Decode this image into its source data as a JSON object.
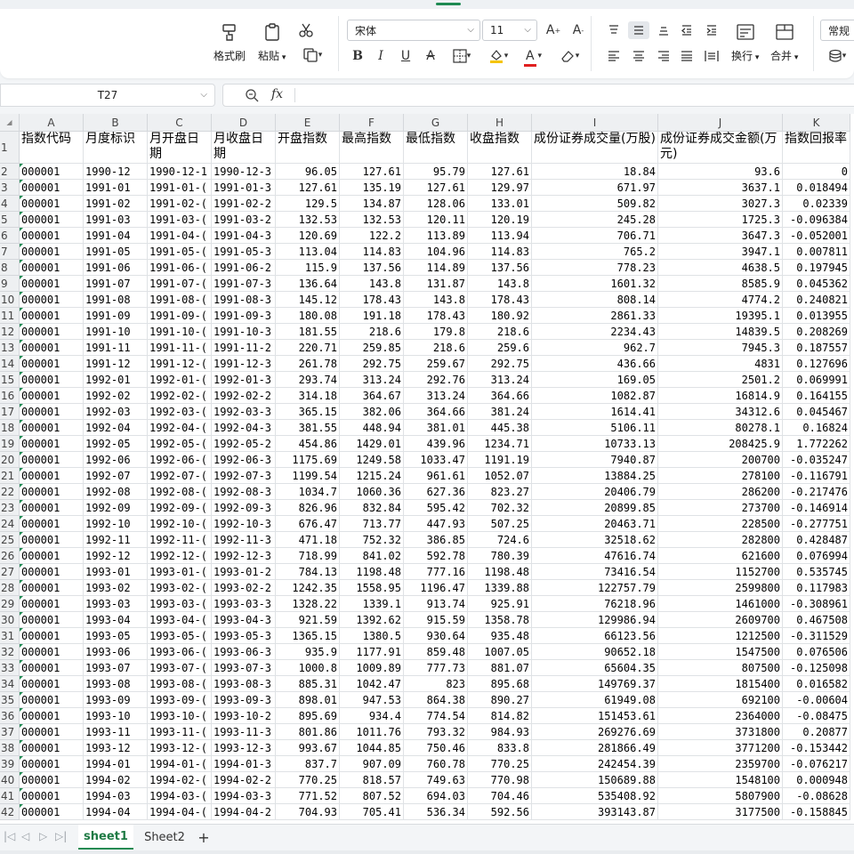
{
  "toolbar": {
    "format_painter": "格式刷",
    "paste": "粘贴",
    "font_name": "宋体",
    "font_size": "11",
    "wrap": "换行",
    "merge": "合并",
    "number_format": "常规",
    "bold": "B",
    "italic": "I",
    "underline": "U",
    "strike": "A",
    "font_color_letter": "A"
  },
  "formula_bar": {
    "name_box": "T27",
    "fx_label": "fx",
    "value": ""
  },
  "columns": [
    "A",
    "B",
    "C",
    "D",
    "E",
    "F",
    "G",
    "H",
    "I",
    "J",
    "K"
  ],
  "header_row": [
    "指数代码",
    "月度标识",
    "月开盘日期",
    "月收盘日期",
    "开盘指数",
    "最高指数",
    "最低指数",
    "收盘指数",
    "成份证券成交量(万股)",
    "成份证券成交金额(万元)",
    "指数回报率"
  ],
  "row_numbers": [
    "1",
    "2",
    "3",
    "4",
    "5",
    "6",
    "7",
    "8",
    "9",
    "10",
    "11",
    "12",
    "13",
    "14",
    "15",
    "16",
    "17",
    "18",
    "19",
    "20",
    "21",
    "22",
    "23",
    "24",
    "25",
    "26",
    "27",
    "28",
    "29",
    "30",
    "31",
    "32",
    "33",
    "34",
    "35",
    "36",
    "37",
    "38",
    "39",
    "40",
    "41",
    "42"
  ],
  "rows": [
    [
      "000001",
      "1990-12",
      "1990-12-1",
      "1990-12-3",
      "96.05",
      "127.61",
      "95.79",
      "127.61",
      "18.84",
      "93.6",
      "0"
    ],
    [
      "000001",
      "1991-01",
      "1991-01-(",
      "1991-01-3",
      "127.61",
      "135.19",
      "127.61",
      "129.97",
      "671.97",
      "3637.1",
      "0.018494"
    ],
    [
      "000001",
      "1991-02",
      "1991-02-(",
      "1991-02-2",
      "129.5",
      "134.87",
      "128.06",
      "133.01",
      "509.82",
      "3027.3",
      "0.02339"
    ],
    [
      "000001",
      "1991-03",
      "1991-03-(",
      "1991-03-2",
      "132.53",
      "132.53",
      "120.11",
      "120.19",
      "245.28",
      "1725.3",
      "-0.096384"
    ],
    [
      "000001",
      "1991-04",
      "1991-04-(",
      "1991-04-3",
      "120.69",
      "122.2",
      "113.89",
      "113.94",
      "706.71",
      "3647.3",
      "-0.052001"
    ],
    [
      "000001",
      "1991-05",
      "1991-05-(",
      "1991-05-3",
      "113.04",
      "114.83",
      "104.96",
      "114.83",
      "765.2",
      "3947.1",
      "0.007811"
    ],
    [
      "000001",
      "1991-06",
      "1991-06-(",
      "1991-06-2",
      "115.9",
      "137.56",
      "114.89",
      "137.56",
      "778.23",
      "4638.5",
      "0.197945"
    ],
    [
      "000001",
      "1991-07",
      "1991-07-(",
      "1991-07-3",
      "136.64",
      "143.8",
      "131.87",
      "143.8",
      "1601.32",
      "8585.9",
      "0.045362"
    ],
    [
      "000001",
      "1991-08",
      "1991-08-(",
      "1991-08-3",
      "145.12",
      "178.43",
      "143.8",
      "178.43",
      "808.14",
      "4774.2",
      "0.240821"
    ],
    [
      "000001",
      "1991-09",
      "1991-09-(",
      "1991-09-3",
      "180.08",
      "191.18",
      "178.43",
      "180.92",
      "2861.33",
      "19395.1",
      "0.013955"
    ],
    [
      "000001",
      "1991-10",
      "1991-10-(",
      "1991-10-3",
      "181.55",
      "218.6",
      "179.8",
      "218.6",
      "2234.43",
      "14839.5",
      "0.208269"
    ],
    [
      "000001",
      "1991-11",
      "1991-11-(",
      "1991-11-2",
      "220.71",
      "259.85",
      "218.6",
      "259.6",
      "962.7",
      "7945.3",
      "0.187557"
    ],
    [
      "000001",
      "1991-12",
      "1991-12-(",
      "1991-12-3",
      "261.78",
      "292.75",
      "259.67",
      "292.75",
      "436.66",
      "4831",
      "0.127696"
    ],
    [
      "000001",
      "1992-01",
      "1992-01-(",
      "1992-01-3",
      "293.74",
      "313.24",
      "292.76",
      "313.24",
      "169.05",
      "2501.2",
      "0.069991"
    ],
    [
      "000001",
      "1992-02",
      "1992-02-(",
      "1992-02-2",
      "314.18",
      "364.67",
      "313.24",
      "364.66",
      "1082.87",
      "16814.9",
      "0.164155"
    ],
    [
      "000001",
      "1992-03",
      "1992-03-(",
      "1992-03-3",
      "365.15",
      "382.06",
      "364.66",
      "381.24",
      "1614.41",
      "34312.6",
      "0.045467"
    ],
    [
      "000001",
      "1992-04",
      "1992-04-(",
      "1992-04-3",
      "381.55",
      "448.94",
      "381.01",
      "445.38",
      "5106.11",
      "80278.1",
      "0.16824"
    ],
    [
      "000001",
      "1992-05",
      "1992-05-(",
      "1992-05-2",
      "454.86",
      "1429.01",
      "439.96",
      "1234.71",
      "10733.13",
      "208425.9",
      "1.772262"
    ],
    [
      "000001",
      "1992-06",
      "1992-06-(",
      "1992-06-3",
      "1175.69",
      "1249.58",
      "1033.47",
      "1191.19",
      "7940.87",
      "200700",
      "-0.035247"
    ],
    [
      "000001",
      "1992-07",
      "1992-07-(",
      "1992-07-3",
      "1199.54",
      "1215.24",
      "961.61",
      "1052.07",
      "13884.25",
      "278100",
      "-0.116791"
    ],
    [
      "000001",
      "1992-08",
      "1992-08-(",
      "1992-08-3",
      "1034.7",
      "1060.36",
      "627.36",
      "823.27",
      "20406.79",
      "286200",
      "-0.217476"
    ],
    [
      "000001",
      "1992-09",
      "1992-09-(",
      "1992-09-3",
      "826.96",
      "832.84",
      "595.42",
      "702.32",
      "20899.85",
      "273700",
      "-0.146914"
    ],
    [
      "000001",
      "1992-10",
      "1992-10-(",
      "1992-10-3",
      "676.47",
      "713.77",
      "447.93",
      "507.25",
      "20463.71",
      "228500",
      "-0.277751"
    ],
    [
      "000001",
      "1992-11",
      "1992-11-(",
      "1992-11-3",
      "471.18",
      "752.32",
      "386.85",
      "724.6",
      "32518.62",
      "282800",
      "0.428487"
    ],
    [
      "000001",
      "1992-12",
      "1992-12-(",
      "1992-12-3",
      "718.99",
      "841.02",
      "592.78",
      "780.39",
      "47616.74",
      "621600",
      "0.076994"
    ],
    [
      "000001",
      "1993-01",
      "1993-01-(",
      "1993-01-2",
      "784.13",
      "1198.48",
      "777.16",
      "1198.48",
      "73416.54",
      "1152700",
      "0.535745"
    ],
    [
      "000001",
      "1993-02",
      "1993-02-(",
      "1993-02-2",
      "1242.35",
      "1558.95",
      "1196.47",
      "1339.88",
      "122757.79",
      "2599800",
      "0.117983"
    ],
    [
      "000001",
      "1993-03",
      "1993-03-(",
      "1993-03-3",
      "1328.22",
      "1339.1",
      "913.74",
      "925.91",
      "76218.96",
      "1461000",
      "-0.308961"
    ],
    [
      "000001",
      "1993-04",
      "1993-04-(",
      "1993-04-3",
      "921.59",
      "1392.62",
      "915.59",
      "1358.78",
      "129986.94",
      "2609700",
      "0.467508"
    ],
    [
      "000001",
      "1993-05",
      "1993-05-(",
      "1993-05-3",
      "1365.15",
      "1380.5",
      "930.64",
      "935.48",
      "66123.56",
      "1212500",
      "-0.311529"
    ],
    [
      "000001",
      "1993-06",
      "1993-06-(",
      "1993-06-3",
      "935.9",
      "1177.91",
      "859.48",
      "1007.05",
      "90652.18",
      "1547500",
      "0.076506"
    ],
    [
      "000001",
      "1993-07",
      "1993-07-(",
      "1993-07-3",
      "1000.8",
      "1009.89",
      "777.73",
      "881.07",
      "65604.35",
      "807500",
      "-0.125098"
    ],
    [
      "000001",
      "1993-08",
      "1993-08-(",
      "1993-08-3",
      "885.31",
      "1042.47",
      "823",
      "895.68",
      "149769.37",
      "1815400",
      "0.016582"
    ],
    [
      "000001",
      "1993-09",
      "1993-09-(",
      "1993-09-3",
      "898.01",
      "947.53",
      "864.38",
      "890.27",
      "61949.08",
      "692100",
      "-0.00604"
    ],
    [
      "000001",
      "1993-10",
      "1993-10-(",
      "1993-10-2",
      "895.69",
      "934.4",
      "774.54",
      "814.82",
      "151453.61",
      "2364000",
      "-0.08475"
    ],
    [
      "000001",
      "1993-11",
      "1993-11-(",
      "1993-11-3",
      "801.86",
      "1011.76",
      "793.32",
      "984.93",
      "269276.69",
      "3731800",
      "0.20877"
    ],
    [
      "000001",
      "1993-12",
      "1993-12-(",
      "1993-12-3",
      "993.67",
      "1044.85",
      "750.46",
      "833.8",
      "281866.49",
      "3771200",
      "-0.153442"
    ],
    [
      "000001",
      "1994-01",
      "1994-01-(",
      "1994-01-3",
      "837.7",
      "907.09",
      "760.78",
      "770.25",
      "242454.39",
      "2359700",
      "-0.076217"
    ],
    [
      "000001",
      "1994-02",
      "1994-02-(",
      "1994-02-2",
      "770.25",
      "818.57",
      "749.63",
      "770.98",
      "150689.88",
      "1548100",
      "0.000948"
    ],
    [
      "000001",
      "1994-03",
      "1994-03-(",
      "1994-03-3",
      "771.52",
      "807.52",
      "694.03",
      "704.46",
      "535408.92",
      "5807900",
      "-0.08628"
    ],
    [
      "000001",
      "1994-04",
      "1994-04-(",
      "1994-04-2",
      "704.93",
      "705.41",
      "536.34",
      "592.56",
      "393143.87",
      "3177500",
      "-0.158845"
    ]
  ],
  "sheet_tabs": [
    "sheet1",
    "Sheet2"
  ],
  "add_sheet": "+",
  "colors": {
    "accent": "#1e8a52",
    "highlight": "#f5c400",
    "font_color": "#e02020"
  }
}
